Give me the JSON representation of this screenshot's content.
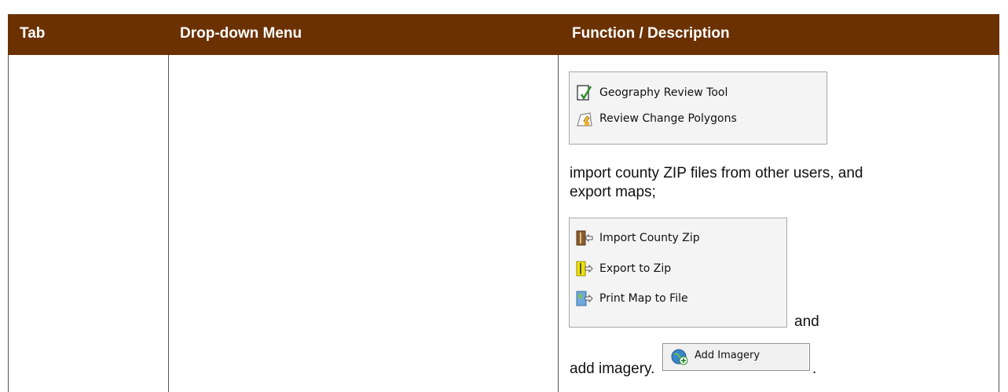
{
  "header": {
    "col1": "Tab",
    "col2": "Drop-down Menu",
    "col3": "Function / Description"
  },
  "review_menu": {
    "items": [
      {
        "label": "Geography Review Tool",
        "icon": "geography-review-icon"
      },
      {
        "label": "Review Change Polygons",
        "icon": "review-polygons-icon"
      }
    ]
  },
  "description": {
    "text1_line1": "import county ZIP files from other users, and",
    "text1_line2": "export maps;",
    "and_text": "and",
    "add_imagery_text": "add imagery.",
    "period": "."
  },
  "file_menu": {
    "items": [
      {
        "label": "Import County Zip",
        "icon": "import-zip-icon"
      },
      {
        "label": "Export to Zip",
        "icon": "export-zip-icon"
      },
      {
        "label": "Print Map to File",
        "icon": "print-map-icon"
      }
    ]
  },
  "add_imagery_button": {
    "label": "Add Imagery",
    "icon": "add-imagery-icon"
  },
  "colors": {
    "header_bg": "#6b3100",
    "header_text": "#ffffff"
  }
}
